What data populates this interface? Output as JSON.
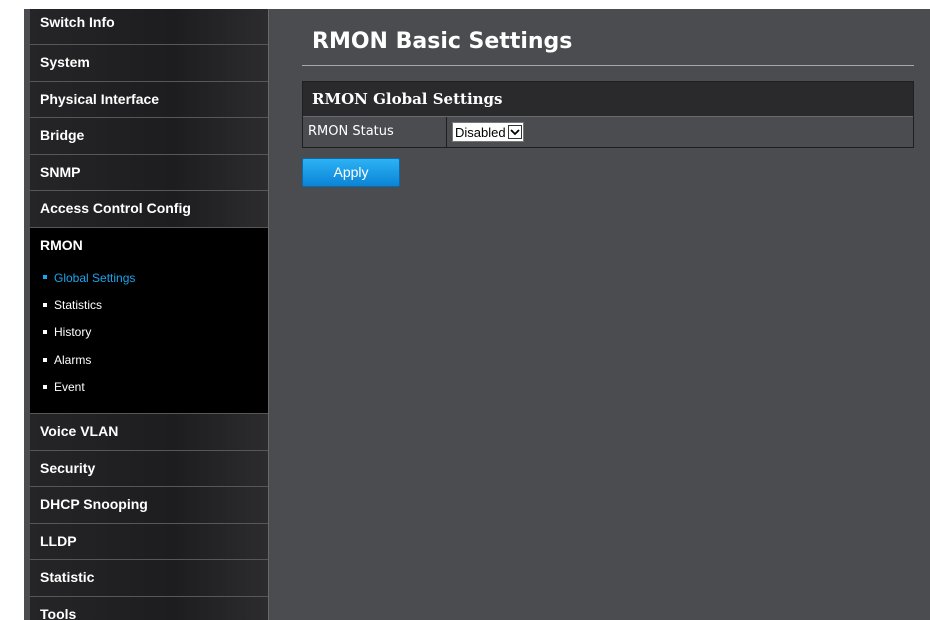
{
  "sidebar": {
    "items_before": [
      {
        "label": "Switch Info"
      },
      {
        "label": "System"
      },
      {
        "label": "Physical Interface"
      },
      {
        "label": "Bridge"
      },
      {
        "label": "SNMP"
      },
      {
        "label": "Access Control Config"
      }
    ],
    "active": {
      "label": "RMON",
      "subitems": [
        {
          "label": "Global Settings",
          "selected": true
        },
        {
          "label": "Statistics"
        },
        {
          "label": "History"
        },
        {
          "label": "Alarms"
        },
        {
          "label": "Event"
        }
      ]
    },
    "items_after": [
      {
        "label": "Voice VLAN"
      },
      {
        "label": "Security"
      },
      {
        "label": "DHCP Snooping"
      },
      {
        "label": "LLDP"
      },
      {
        "label": "Statistic"
      },
      {
        "label": "Tools"
      }
    ]
  },
  "main": {
    "title": "RMON Basic Settings",
    "table": {
      "header": "RMON Global Settings",
      "row_label": "RMON Status",
      "status_value": "Disabled"
    },
    "apply_label": "Apply"
  },
  "colors": {
    "accent": "#1aa3ee",
    "panel_bg": "#4b4c50",
    "sidebar_bg": "#111112"
  }
}
